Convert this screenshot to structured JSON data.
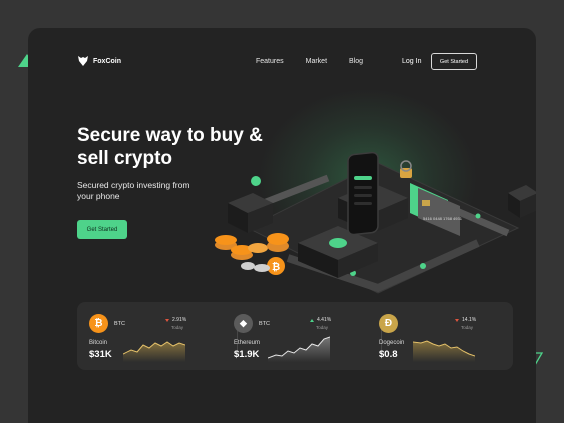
{
  "nav": {
    "logo_text": "FoxCoin",
    "links": [
      "Features",
      "Market",
      "Blog"
    ],
    "login": "Log In",
    "cta": "Get Started"
  },
  "hero": {
    "headline": "Secure way to buy & sell crypto",
    "subtext": "Secured crypto investing from your phone",
    "cta": "Get Started",
    "card_number": "5416 0448 1768 4931"
  },
  "stats": [
    {
      "symbol": "BTC",
      "change": "2.91%",
      "direction": "down",
      "period": "Today",
      "name": "Bitcoin",
      "price": "$31K",
      "icon": "bitcoin-icon",
      "color": "#f7931a",
      "glyph": "₿"
    },
    {
      "symbol": "BTC",
      "change": "4.41%",
      "direction": "up",
      "period": "Today",
      "name": "Ethereum",
      "price": "$1.9K",
      "icon": "ethereum-icon",
      "color": "#5b5b5b",
      "glyph": "◆"
    },
    {
      "symbol": "",
      "change": "14.1%",
      "direction": "down",
      "period": "Today",
      "name": "Dogecoin",
      "price": "$0.8",
      "icon": "dogecoin-icon",
      "color": "#c9a54a",
      "glyph": "Ð"
    }
  ],
  "colors": {
    "accent": "#4ed38a",
    "background": "#232323",
    "down": "#e0553f",
    "up": "#4ed38a"
  }
}
